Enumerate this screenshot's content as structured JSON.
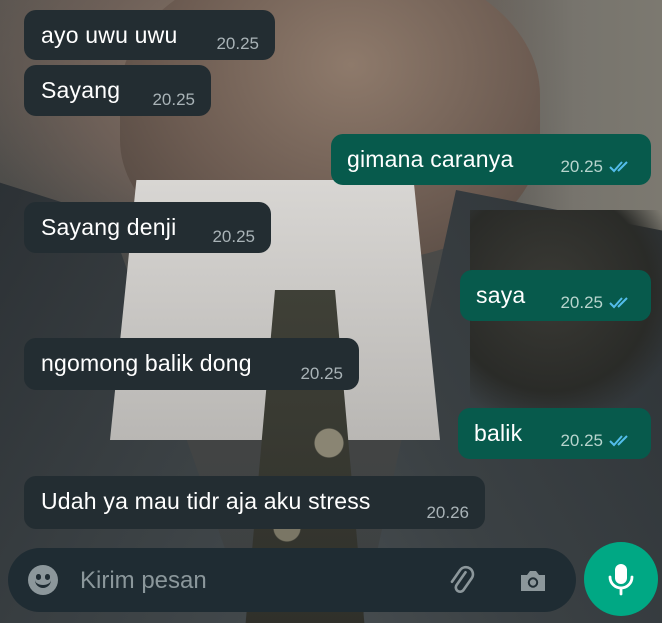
{
  "messages": [
    {
      "text": "ayo uwu uwu",
      "time": "20.25",
      "direction": "incoming"
    },
    {
      "text": "Sayang",
      "time": "20.25",
      "direction": "incoming"
    },
    {
      "text": "gimana caranya",
      "time": "20.25",
      "direction": "outgoing",
      "status": "read"
    },
    {
      "text": "Sayang denji",
      "time": "20.25",
      "direction": "incoming"
    },
    {
      "text": "saya",
      "time": "20.25",
      "direction": "outgoing",
      "status": "read"
    },
    {
      "text": "ngomong balik dong",
      "time": "20.25",
      "direction": "incoming"
    },
    {
      "text": "balik",
      "time": "20.25",
      "direction": "outgoing",
      "status": "read"
    },
    {
      "text": "Udah ya mau tidr aja aku stress",
      "time": "20.26",
      "direction": "incoming"
    }
  ],
  "composer": {
    "placeholder": "Kirim pesan",
    "value": "",
    "icons": [
      "emoji-icon",
      "paperclip-icon",
      "camera-icon",
      "microphone-icon"
    ]
  },
  "colors": {
    "incoming_bubble": "#232d32",
    "outgoing_bubble": "#075a4c",
    "read_ticks": "#53bdeb",
    "mic_button": "#00a884",
    "composer_bg": "#1f2c33"
  }
}
